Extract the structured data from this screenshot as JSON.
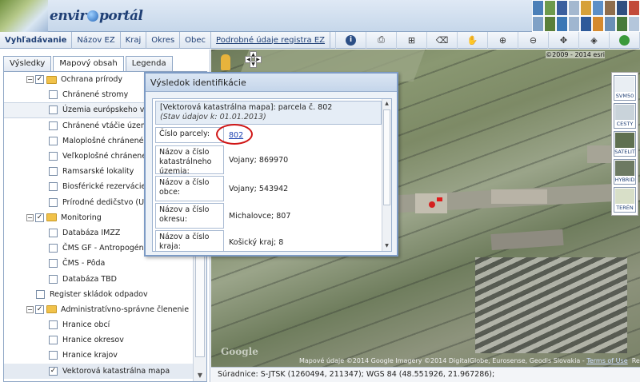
{
  "header": {
    "logo_prefix": "envir",
    "logo_suffix": "portál"
  },
  "toolbar": {
    "links": [
      {
        "label": "Vyhľadávanie",
        "active": true
      },
      {
        "label": "Názov EZ"
      },
      {
        "label": "Kraj"
      },
      {
        "label": "Okres"
      },
      {
        "label": "Obec"
      },
      {
        "label": "Podrobné údaje registra EZ",
        "underline": true
      }
    ],
    "icons": [
      "info-icon",
      "print-icon",
      "measure-icon",
      "eraser-icon",
      "hand-pan-icon",
      "zoom-in-icon",
      "zoom-out-icon",
      "zoom-extent-icon",
      "zoom-previous-icon",
      "globe-icon",
      "help-icon"
    ]
  },
  "tabs": [
    {
      "label": "Výsledky",
      "active": false
    },
    {
      "label": "Mapový obsah",
      "active": true
    },
    {
      "label": "Legenda",
      "active": false
    }
  ],
  "tree": [
    {
      "label": "Ochrana prírody",
      "level": 0,
      "expander": "−",
      "checked": true,
      "folder": true
    },
    {
      "label": "Chránené stromy",
      "level": 1,
      "checked": false
    },
    {
      "label": "Územia európskeho výz",
      "level": 1,
      "checked": false,
      "highlight": true
    },
    {
      "label": "Chránené vtáčie územia",
      "level": 1,
      "checked": false
    },
    {
      "label": "Maloplošné chránené úz",
      "level": 1,
      "checked": false
    },
    {
      "label": "Veľkoplošné chránené ú",
      "level": 1,
      "checked": false
    },
    {
      "label": "Ramsarské lokality",
      "level": 1,
      "checked": false
    },
    {
      "label": "Biosférické rezervácie",
      "level": 1,
      "checked": false
    },
    {
      "label": "Prírodné dedičstvo (UNE",
      "level": 1,
      "checked": false
    },
    {
      "label": "Monitoring",
      "level": 0,
      "expander": "−",
      "checked": true,
      "folder": true
    },
    {
      "label": "Databáza IMZZ",
      "level": 1,
      "checked": false
    },
    {
      "label": "ČMS GF - Antropogénne",
      "level": 1,
      "checked": false
    },
    {
      "label": "ČMS - Pôda",
      "level": 1,
      "checked": false
    },
    {
      "label": "Databáza TBD",
      "level": 1,
      "checked": false
    },
    {
      "label": "Register skládok odpadov",
      "level": 0,
      "checked": false
    },
    {
      "label": "Administratívno-správne členenie",
      "level": 0,
      "expander": "−",
      "checked": true,
      "folder": true
    },
    {
      "label": "Hranice obcí",
      "level": 1,
      "checked": false
    },
    {
      "label": "Hranice okresov",
      "level": 1,
      "checked": false
    },
    {
      "label": "Hranice krajov",
      "level": 1,
      "checked": false
    },
    {
      "label": "Vektorová katastrálna mapa",
      "level": 1,
      "checked": true,
      "selected": true
    }
  ],
  "popup": {
    "title": "Výsledok identifikácie",
    "header_line1": "[Vektorová katastrálna mapa]: parcela č. 802",
    "header_line2": "(Stav údajov k: 01.01.2013)",
    "rows": [
      {
        "label": "Číslo parcely:",
        "value": "802",
        "link": true
      },
      {
        "label": "Názov a číslo katastrálneho územia:",
        "value": "Vojany; 869970"
      },
      {
        "label": "Názov a číslo obce:",
        "value": "Vojany; 543942"
      },
      {
        "label": "Názov a číslo okresu:",
        "value": "Michalovce; 807"
      },
      {
        "label": "Názov a číslo kraja:",
        "value": "Košický kraj; 8"
      }
    ]
  },
  "map": {
    "copyright_top": "©2009 - 2014 esri",
    "copyright_bottom": "Mapové údaje ©2014 Google Imagery ©2014 DigitalGlobe, Eurosense, Geodis Slovakia - ",
    "terms": "Terms of Use",
    "report": "Report a map error",
    "google": "Google",
    "map_types": [
      {
        "label": "SVM50",
        "color": "#e9eef3"
      },
      {
        "label": "CESTY",
        "color": "#c9d3da"
      },
      {
        "label": "SATELIT",
        "color": "#5f7050"
      },
      {
        "label": "HYBRID",
        "color": "#6d7a62"
      },
      {
        "label": "TERÉN",
        "color": "#d8dfc8"
      }
    ]
  },
  "status": {
    "text": "Súradnice: S-JTSK (1260494, 211347);    WGS 84 (48.551926, 21.967286);"
  }
}
